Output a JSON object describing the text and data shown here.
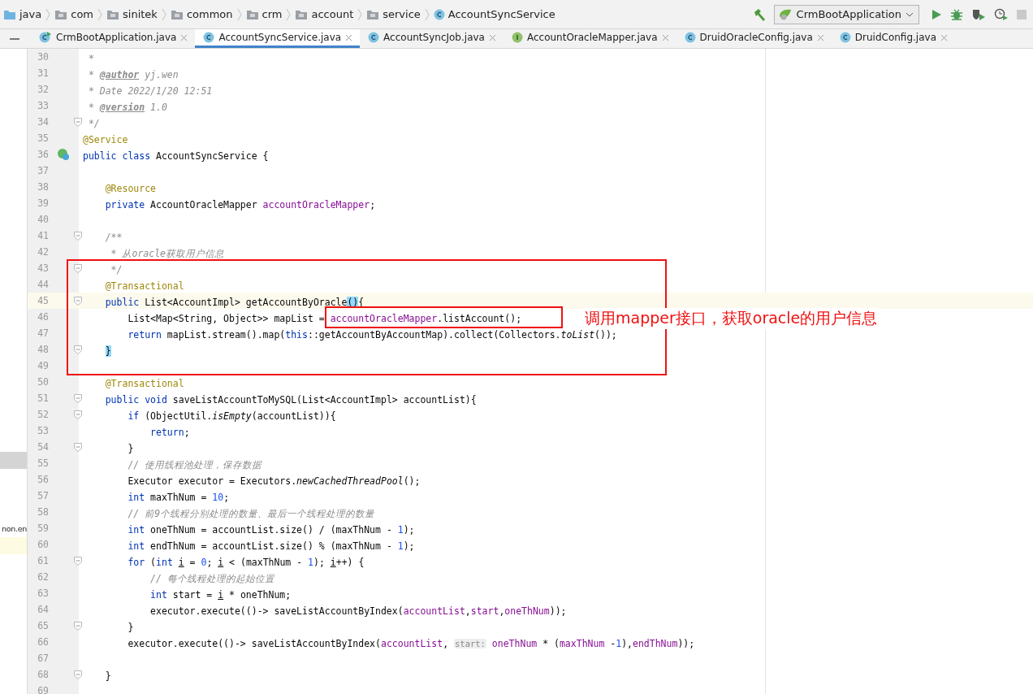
{
  "breadcrumbs": [
    {
      "label": "java",
      "kind": "source"
    },
    {
      "label": "com",
      "kind": "package"
    },
    {
      "label": "sinitek",
      "kind": "package"
    },
    {
      "label": "common",
      "kind": "package"
    },
    {
      "label": "crm",
      "kind": "package"
    },
    {
      "label": "account",
      "kind": "package"
    },
    {
      "label": "service",
      "kind": "package"
    },
    {
      "label": "AccountSyncService",
      "kind": "class"
    }
  ],
  "toolbar": {
    "run_configuration": "CrmBootApplication"
  },
  "tabs": [
    {
      "label": "CrmBootApplication.java",
      "kind": "application",
      "selected": false
    },
    {
      "label": "AccountSyncService.java",
      "kind": "class",
      "selected": true
    },
    {
      "label": "AccountSyncJob.java",
      "kind": "class",
      "selected": false
    },
    {
      "label": "AccountOracleMapper.java",
      "kind": "interface",
      "selected": false
    },
    {
      "label": "DruidOracleConfig.java",
      "kind": "class",
      "selected": false
    },
    {
      "label": "DruidConfig.java",
      "kind": "class",
      "selected": false
    }
  ],
  "project_tree": {
    "rows": [
      {
        "selected": true,
        "highlighted": false
      },
      {
        "label": "non.en",
        "selected": false,
        "highlighted": false
      },
      {
        "selected": false,
        "highlighted": true
      }
    ]
  },
  "editor": {
    "lines": [
      {
        "number": "30",
        "tokens": [
          {
            "kind": "doc",
            "text": " *"
          }
        ]
      },
      {
        "number": "31",
        "tokens": [
          {
            "kind": "doc",
            "text": " * "
          },
          {
            "kind": "tag",
            "text": "@author"
          },
          {
            "kind": "doc",
            "text": " yj.wen"
          }
        ]
      },
      {
        "number": "32",
        "tokens": [
          {
            "kind": "doc",
            "text": " * Date 2022/1/20 12:51"
          }
        ]
      },
      {
        "number": "33",
        "tokens": [
          {
            "kind": "doc",
            "text": " * "
          },
          {
            "kind": "tag",
            "text": "@version"
          },
          {
            "kind": "doc",
            "text": " 1.0"
          }
        ]
      },
      {
        "number": "34",
        "fold": true,
        "tokens": [
          {
            "kind": "doc",
            "text": " */"
          }
        ]
      },
      {
        "number": "35",
        "tokens": [
          {
            "kind": "ann",
            "text": "@Service"
          }
        ]
      },
      {
        "number": "36",
        "bean": true,
        "tokens": [
          {
            "kind": "kw",
            "text": "public class "
          },
          {
            "kind": "plain",
            "text": "AccountSyncService {"
          }
        ]
      },
      {
        "number": "37"
      },
      {
        "number": "38",
        "tokens": [
          {
            "kind": "ann",
            "text": "    @Resource"
          }
        ]
      },
      {
        "number": "39",
        "tokens": [
          {
            "kind": "kw",
            "text": "    private "
          },
          {
            "kind": "plain",
            "text": "AccountOracleMapper "
          },
          {
            "kind": "fld",
            "text": "accountOracleMapper"
          },
          {
            "kind": "plain",
            "text": ";"
          }
        ]
      },
      {
        "number": "40"
      },
      {
        "number": "41",
        "fold": true,
        "tokens": [
          {
            "kind": "doc",
            "text": "    /**"
          }
        ]
      },
      {
        "number": "42",
        "tokens": [
          {
            "kind": "doc",
            "text": "     * 从oracle获取用户信息"
          }
        ]
      },
      {
        "number": "43",
        "fold": true,
        "tokens": [
          {
            "kind": "doc",
            "text": "     */"
          }
        ]
      },
      {
        "number": "44",
        "tokens": [
          {
            "kind": "ann",
            "text": "    @Transactional"
          }
        ]
      },
      {
        "number": "45",
        "fold": true,
        "current": true,
        "tokens": [
          {
            "kind": "kw",
            "text": "    public "
          },
          {
            "kind": "plain",
            "text": "List<AccountImpl> getAccountByOracle"
          },
          {
            "kind": "match",
            "text": "()"
          },
          {
            "kind": "plain",
            "text": "{"
          }
        ]
      },
      {
        "number": "46",
        "tokens": [
          {
            "kind": "plain",
            "text": "        List<Map<String, Object>> mapList = "
          },
          {
            "kind": "fld",
            "text": "accountOracleMapper"
          },
          {
            "kind": "plain",
            "text": ".listAccount();"
          }
        ]
      },
      {
        "number": "47",
        "tokens": [
          {
            "kind": "kw",
            "text": "        return "
          },
          {
            "kind": "plain",
            "text": "mapList.stream().map("
          },
          {
            "kind": "kw",
            "text": "this"
          },
          {
            "kind": "plain",
            "text": "::getAccountByAccountMap).collect(Collectors."
          },
          {
            "kind": "static",
            "text": "toList"
          },
          {
            "kind": "plain",
            "text": "());"
          }
        ]
      },
      {
        "number": "48",
        "fold": true,
        "tokens": [
          {
            "kind": "match",
            "text": "    }"
          }
        ]
      },
      {
        "number": "49"
      },
      {
        "number": "50",
        "tokens": [
          {
            "kind": "ann",
            "text": "    @Transactional"
          }
        ]
      },
      {
        "number": "51",
        "fold": true,
        "tokens": [
          {
            "kind": "kw",
            "text": "    public void "
          },
          {
            "kind": "plain",
            "text": "saveListAccountToMySQL(List<AccountImpl> accountList){"
          }
        ]
      },
      {
        "number": "52",
        "fold": true,
        "tokens": [
          {
            "kind": "kw",
            "text": "        if "
          },
          {
            "kind": "plain",
            "text": "(ObjectUtil."
          },
          {
            "kind": "static",
            "text": "isEmpty"
          },
          {
            "kind": "plain",
            "text": "(accountList)){"
          }
        ]
      },
      {
        "number": "53",
        "tokens": [
          {
            "kind": "kw",
            "text": "            return"
          },
          {
            "kind": "plain",
            "text": ";"
          }
        ]
      },
      {
        "number": "54",
        "fold": true,
        "tokens": [
          {
            "kind": "plain",
            "text": "        }"
          }
        ]
      },
      {
        "number": "55",
        "tokens": [
          {
            "kind": "cm",
            "text": "        // 使用线程池处理，保存数据"
          }
        ]
      },
      {
        "number": "56",
        "tokens": [
          {
            "kind": "plain",
            "text": "        Executor executor = Executors."
          },
          {
            "kind": "static",
            "text": "newCachedThreadPool"
          },
          {
            "kind": "plain",
            "text": "();"
          }
        ]
      },
      {
        "number": "57",
        "tokens": [
          {
            "kind": "kw",
            "text": "        int "
          },
          {
            "kind": "plain",
            "text": "maxThNum = "
          },
          {
            "kind": "num",
            "text": "10"
          },
          {
            "kind": "plain",
            "text": ";"
          }
        ]
      },
      {
        "number": "58",
        "tokens": [
          {
            "kind": "cm",
            "text": "        // 前9个线程分别处理的数量、最后一个线程处理的数量"
          }
        ]
      },
      {
        "number": "59",
        "tokens": [
          {
            "kind": "kw",
            "text": "        int "
          },
          {
            "kind": "plain",
            "text": "oneThNum = accountList.size() / (maxThNum - "
          },
          {
            "kind": "num",
            "text": "1"
          },
          {
            "kind": "plain",
            "text": ");"
          }
        ]
      },
      {
        "number": "60",
        "tokens": [
          {
            "kind": "kw",
            "text": "        int "
          },
          {
            "kind": "plain",
            "text": "endThNum = accountList.size() % (maxThNum - "
          },
          {
            "kind": "num",
            "text": "1"
          },
          {
            "kind": "plain",
            "text": ");"
          }
        ]
      },
      {
        "number": "61",
        "fold": true,
        "tokens": [
          {
            "kind": "kw",
            "text": "        for "
          },
          {
            "kind": "plain",
            "text": "("
          },
          {
            "kind": "kw",
            "text": "int "
          },
          {
            "kind": "var",
            "text": "i"
          },
          {
            "kind": "plain",
            "text": " = "
          },
          {
            "kind": "num",
            "text": "0"
          },
          {
            "kind": "plain",
            "text": "; "
          },
          {
            "kind": "var",
            "text": "i"
          },
          {
            "kind": "plain",
            "text": " < (maxThNum - "
          },
          {
            "kind": "num",
            "text": "1"
          },
          {
            "kind": "plain",
            "text": "); "
          },
          {
            "kind": "var",
            "text": "i"
          },
          {
            "kind": "plain",
            "text": "++) {"
          }
        ]
      },
      {
        "number": "62",
        "tokens": [
          {
            "kind": "cm",
            "text": "            // 每个线程处理的起始位置"
          }
        ]
      },
      {
        "number": "63",
        "tokens": [
          {
            "kind": "kw",
            "text": "            int "
          },
          {
            "kind": "plain",
            "text": "start = "
          },
          {
            "kind": "var",
            "text": "i"
          },
          {
            "kind": "plain",
            "text": " * oneThNum;"
          }
        ]
      },
      {
        "number": "64",
        "tokens": [
          {
            "kind": "plain",
            "text": "            executor.execute(()-> saveListAccountByIndex("
          },
          {
            "kind": "fld",
            "text": "accountList"
          },
          {
            "kind": "plain",
            "text": ","
          },
          {
            "kind": "fld",
            "text": "start"
          },
          {
            "kind": "plain",
            "text": ","
          },
          {
            "kind": "fld",
            "text": "oneThNum"
          },
          {
            "kind": "plain",
            "text": "));"
          }
        ]
      },
      {
        "number": "65",
        "fold": true,
        "tokens": [
          {
            "kind": "plain",
            "text": "        }"
          }
        ]
      },
      {
        "number": "66",
        "tokens": [
          {
            "kind": "plain",
            "text": "        executor.execute(()-> saveListAccountByIndex("
          },
          {
            "kind": "fld",
            "text": "accountList"
          },
          {
            "kind": "plain",
            "text": ", "
          },
          {
            "kind": "hint",
            "text": "start:"
          },
          {
            "kind": "fld",
            "text": " oneThNum"
          },
          {
            "kind": "plain",
            "text": " * ("
          },
          {
            "kind": "fld",
            "text": "maxThNum"
          },
          {
            "kind": "plain",
            "text": " -"
          },
          {
            "kind": "num",
            "text": "1"
          },
          {
            "kind": "plain",
            "text": "),"
          },
          {
            "kind": "fld",
            "text": "endThNum"
          },
          {
            "kind": "plain",
            "text": "));"
          }
        ]
      },
      {
        "number": "67"
      },
      {
        "number": "68",
        "fold": true,
        "tokens": [
          {
            "kind": "plain",
            "text": "    }"
          }
        ]
      },
      {
        "number": "69"
      }
    ]
  },
  "annotation": {
    "text": "调用mapper接口，获取oracle的用户信息"
  }
}
